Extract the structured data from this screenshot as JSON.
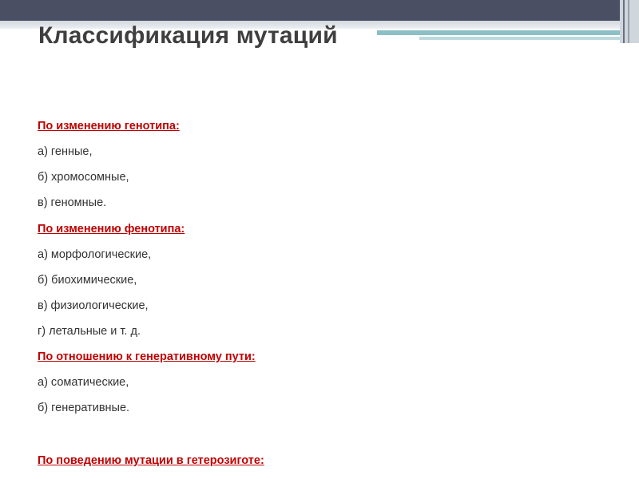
{
  "slide": {
    "title": "Классификация мутаций",
    "sections": [
      {
        "heading": "По изменению генотипа:",
        "items": [
          "а) генные,",
          "б) хромосомные,",
          "в) геномные."
        ]
      },
      {
        "heading": "По изменению фенотипа:",
        "items": [
          "а) морфологические,",
          "б) биохимические,",
          "в) физиологические,",
          "г) летальные и т. д."
        ]
      },
      {
        "heading": "По отношению к генеративному пути:",
        "items": [
          "а) соматические,",
          "б) генеративные."
        ]
      },
      {
        "heading": "По поведению мутации в гетерозиготе:",
        "items": []
      }
    ]
  },
  "colors": {
    "heading": "#c00000",
    "body_text": "#333333",
    "title": "#3f3f3f",
    "top_band": "#4b4f63",
    "accent": "#8cbfc6"
  }
}
